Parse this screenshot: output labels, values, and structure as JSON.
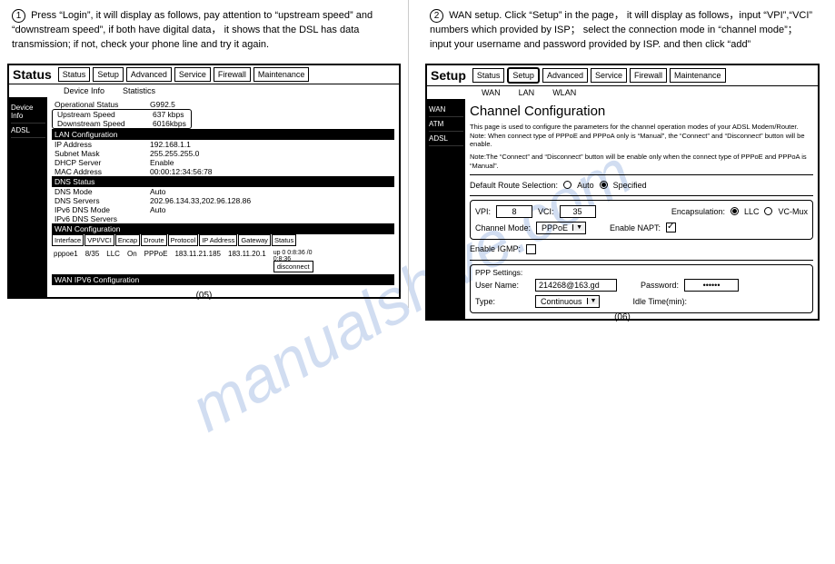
{
  "left": {
    "step": "1",
    "instruction": "Press “Login”, it will display as follows, pay attention to “upstream speed” and “downstream speed”, if both have digital data， it shows that the DSL has data transmission; if not, check your phone line and try it again.",
    "panel_title": "Status",
    "tabs": [
      "Status",
      "Setup",
      "Advanced",
      "Service",
      "Firewall",
      "Maintenance"
    ],
    "subtabs": [
      "Device Info",
      "Statistics"
    ],
    "sidenav": [
      "Device Info",
      "ADSL"
    ],
    "sec_op": "Operational Status",
    "g992": "G992.5",
    "up_lbl": "Upstream Speed",
    "up_val": "637 kbps",
    "down_lbl": "Downstream Speed",
    "down_val": "6016kbps",
    "sec_lan": "LAN Configuration",
    "lan": [
      {
        "l": "IP Address",
        "v": "192.168.1.1"
      },
      {
        "l": "Subnet Mask",
        "v": "255.255.255.0"
      },
      {
        "l": "DHCP Server",
        "v": "Enable"
      },
      {
        "l": "MAC Address",
        "v": "00:00:12:34:56:78"
      }
    ],
    "sec_dns": "DNS Status",
    "dns": [
      {
        "l": "DNS Mode",
        "v": "Auto"
      },
      {
        "l": "DNS Servers",
        "v": "202.96.134.33,202.96.128.86"
      },
      {
        "l": "IPv6 DNS Mode",
        "v": "Auto"
      },
      {
        "l": "IPv6 DNS Servers",
        "v": ""
      }
    ],
    "sec_wan": "WAN Configuration",
    "wan_cols": [
      "Interface",
      "VPI/VCI",
      "Encap",
      "Droute",
      "Protocol",
      "IP Address",
      "Gateway",
      "Status"
    ],
    "wan_row": {
      "if": "pppoe1",
      "vpi": "8/35",
      "enc": "LLC",
      "dr": "On",
      "pr": "PPPoE",
      "ip": "183.11.21.185",
      "gw": "183.11.20.1",
      "st": "up 0 0:8:36 /0 0:8:36"
    },
    "disconnect": "disconnect",
    "sec_wan6": "WAN IPV6 Configuration",
    "pagenum": "(05)"
  },
  "right": {
    "step": "2",
    "instruction": "WAN setup. Click “Setup” in the page， it will display as follows，input “VPI”,“VCI” numbers which provided by ISP； select the connection mode in “channel mode”；input your username and password provided by ISP. and then click “add”",
    "panel_title": "Setup",
    "tabs": [
      "Status",
      "Setup",
      "Advanced",
      "Service",
      "Firewall",
      "Maintenance"
    ],
    "subtabs": [
      "WAN",
      "LAN",
      "WLAN"
    ],
    "sidenav": [
      "WAN",
      "ATM",
      "ADSL"
    ],
    "conf_title": "Channel   Configuration",
    "note1": "This page is used to configure the parameters for the channel operation modes of your ADSL Modem/Router. Note: When connect type of PPPoE and PPPoA only is “Manual”, the “Connect” and “Disconnect” button will be enable.",
    "note2": "Note:The “Connect” and “Disconnect” button will be enable only when the connect type of PPPoE and PPPoA is “Manual”.",
    "def_route": "Default Route Selection:",
    "auto": "Auto",
    "spec": "Specified",
    "vpi_l": "VPI:",
    "vpi_v": "8",
    "vci_l": "VCI:",
    "vci_v": "35",
    "encap_l": "Encapsulation:",
    "llc": "LLC",
    "vcmux": "VC-Mux",
    "cm_l": "Channel Mode:",
    "cm_v": "PPPoE",
    "napt_l": "Enable NAPT:",
    "igmp_l": "Enable IGMP:",
    "ppp_hd": "PPP Settings:",
    "un_l": "User Name:",
    "un_v": "214268@163.gd",
    "pw_l": "Password:",
    "pw_v": "••••••",
    "type_l": "Type:",
    "type_v": "Continuous",
    "idle_l": "Idle Time(min):",
    "pagenum": "(06)"
  },
  "watermark": "manualshive.com"
}
